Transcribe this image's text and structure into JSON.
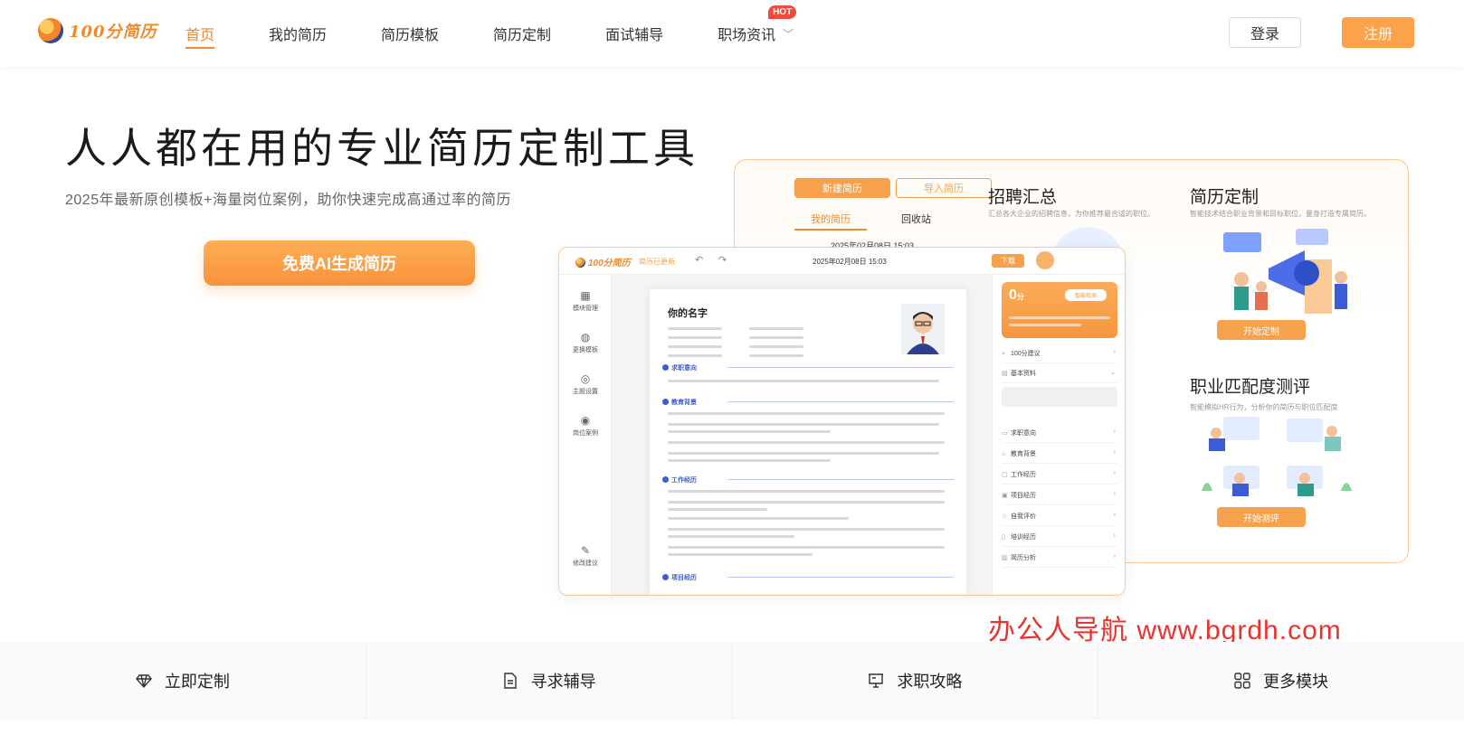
{
  "header": {
    "logo_text": "100分简历",
    "nav": [
      {
        "label": "首页",
        "active": true
      },
      {
        "label": "我的简历"
      },
      {
        "label": "简历模板"
      },
      {
        "label": "简历定制"
      },
      {
        "label": "面试辅导"
      },
      {
        "label": "职场资讯",
        "badge": "HOT",
        "has_dropdown": true
      }
    ],
    "login_label": "登录",
    "register_label": "注册"
  },
  "hero": {
    "title": "人人都在用的专业简历定制工具",
    "subtitle": "2025年最新原创模板+海量岗位案例，助你快速完成高通过率的简历",
    "cta_label": "免费AI生成简历"
  },
  "preview_back": {
    "new_resume": "新建简历",
    "import_resume": "导入简历",
    "tabs": [
      "我的简历",
      "回收站"
    ],
    "date": "2025年02月08日 15:03",
    "cards": [
      {
        "title": "招聘汇总",
        "desc": "汇总各大企业的招聘信息，为你推荐最合适的职位。"
      },
      {
        "title": "简历定制",
        "desc": "智能技术结合职业背景和目标职位，量身打造专属简历。",
        "button": "开始定制"
      },
      {
        "title": "职业匹配度测评",
        "desc": "智能模拟HR行为，分析你的简历与职位匹配度",
        "button": "开始测评"
      }
    ]
  },
  "preview_front": {
    "logo_text": "100分简历",
    "saved_status": "简历已更新",
    "timestamp": "2025年02月08日 15:03",
    "download_label": "下载",
    "sidebar": [
      {
        "label": "模块管理",
        "icon": "grid-icon"
      },
      {
        "label": "更换模板",
        "icon": "palette-icon"
      },
      {
        "label": "主题设置",
        "icon": "theme-icon"
      },
      {
        "label": "岗位案例",
        "icon": "target-icon"
      },
      {
        "label": "修改建议",
        "icon": "edit-icon"
      }
    ],
    "doc": {
      "name": "你的名字",
      "sections": [
        "求职意向",
        "教育背景",
        "工作经历",
        "项目经历"
      ]
    },
    "score": {
      "value": "0",
      "unit": "分",
      "button": "智能检测"
    },
    "panel_items": [
      {
        "label": "100分建议",
        "icon": "search-icon"
      },
      {
        "label": "基本资料",
        "icon": "id-icon"
      },
      {
        "label": "求职意向",
        "icon": "briefcase-icon"
      },
      {
        "label": "教育背景",
        "icon": "cap-icon"
      },
      {
        "label": "工作经历",
        "icon": "monitor-icon"
      },
      {
        "label": "项目经历",
        "icon": "folder-icon"
      },
      {
        "label": "自我评价",
        "icon": "star-icon"
      },
      {
        "label": "培训经历",
        "icon": "book-icon"
      },
      {
        "label": "简历分析",
        "icon": "chart-icon"
      }
    ]
  },
  "watermark": "办公人导航  www.bgrdh.com",
  "bottom_bar": [
    {
      "label": "立即定制",
      "icon": "diamond-icon"
    },
    {
      "label": "寻求辅导",
      "icon": "document-icon"
    },
    {
      "label": "求职攻略",
      "icon": "presentation-icon"
    },
    {
      "label": "更多模块",
      "icon": "grid-icon"
    }
  ],
  "colors": {
    "accent": "#f5862d",
    "button": "#fba24a",
    "hot": "#ef4a3a",
    "watermark": "#e8332e"
  }
}
